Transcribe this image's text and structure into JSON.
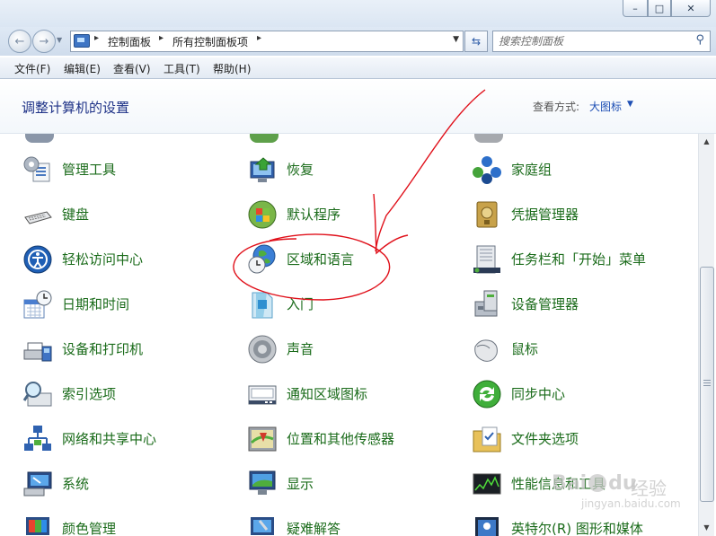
{
  "window": {
    "minimize_glyph": "–",
    "maximize_glyph": "□",
    "close_glyph": "✕"
  },
  "nav": {
    "back_glyph": "←",
    "forward_glyph": "→",
    "breadcrumbs": [
      "控制面板",
      "所有控制面板项"
    ],
    "refresh_glyph": "⇆"
  },
  "search": {
    "placeholder": "搜索控制面板"
  },
  "menu": {
    "items": [
      "文件(F)",
      "编辑(E)",
      "查看(V)",
      "工具(T)",
      "帮助(H)"
    ]
  },
  "header": {
    "title": "调整计算机的设置",
    "view_label": "查看方式:",
    "view_value": "大图标"
  },
  "items": [
    {
      "label": "管理工具",
      "icon": "admin-tools-icon"
    },
    {
      "label": "恢复",
      "icon": "recovery-icon"
    },
    {
      "label": "家庭组",
      "icon": "homegroup-icon"
    },
    {
      "label": "键盘",
      "icon": "keyboard-icon"
    },
    {
      "label": "默认程序",
      "icon": "default-programs-icon"
    },
    {
      "label": "凭据管理器",
      "icon": "credential-manager-icon"
    },
    {
      "label": "轻松访问中心",
      "icon": "ease-of-access-icon"
    },
    {
      "label": "区域和语言",
      "icon": "region-language-icon"
    },
    {
      "label": "任务栏和「开始」菜单",
      "icon": "taskbar-start-icon"
    },
    {
      "label": "日期和时间",
      "icon": "date-time-icon"
    },
    {
      "label": "入门",
      "icon": "getting-started-icon"
    },
    {
      "label": "设备管理器",
      "icon": "device-manager-icon"
    },
    {
      "label": "设备和打印机",
      "icon": "devices-printers-icon"
    },
    {
      "label": "声音",
      "icon": "sound-icon"
    },
    {
      "label": "鼠标",
      "icon": "mouse-icon"
    },
    {
      "label": "索引选项",
      "icon": "indexing-options-icon"
    },
    {
      "label": "通知区域图标",
      "icon": "notification-area-icon"
    },
    {
      "label": "同步中心",
      "icon": "sync-center-icon"
    },
    {
      "label": "网络和共享中心",
      "icon": "network-sharing-icon"
    },
    {
      "label": "位置和其他传感器",
      "icon": "location-sensors-icon"
    },
    {
      "label": "文件夹选项",
      "icon": "folder-options-icon"
    },
    {
      "label": "系统",
      "icon": "system-icon"
    },
    {
      "label": "显示",
      "icon": "display-icon"
    },
    {
      "label": "性能信息和工具",
      "icon": "performance-icon"
    },
    {
      "label": "颜色管理",
      "icon": "color-management-icon"
    },
    {
      "label": "疑难解答",
      "icon": "troubleshooting-icon"
    },
    {
      "label": "英特尔(R) 图形和媒体",
      "icon": "intel-graphics-icon"
    }
  ],
  "watermark": {
    "brand": "Bai",
    "brand2": "du",
    "site_cn": "经验",
    "site_url": "jingyan.baidu.com"
  },
  "colors": {
    "link_green": "#1a6b1a",
    "title_blue": "#1e3287",
    "annotation_red": "#e0101a"
  }
}
